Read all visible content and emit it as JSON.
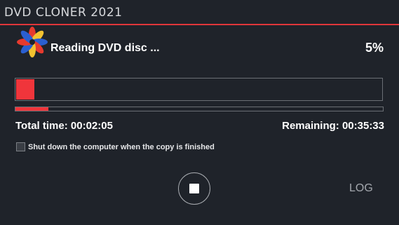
{
  "app": {
    "title": "DVD CLONER 2021"
  },
  "status": {
    "text": "Reading DVD disc ...",
    "percent_label": "5%",
    "main_progress": 0.05,
    "sub_progress": 0.09
  },
  "times": {
    "total": "Total time: 00:02:05",
    "remaining": "Remaining: 00:35:33"
  },
  "options": {
    "shutdown_label": "Shut down the computer when the copy is finished",
    "shutdown_checked": false
  },
  "controls": {
    "stop_icon": "stop-icon",
    "log_label": "LOG"
  },
  "colors": {
    "accent": "#f0353b",
    "background": "#1f232a",
    "separator": "#e0363a"
  }
}
